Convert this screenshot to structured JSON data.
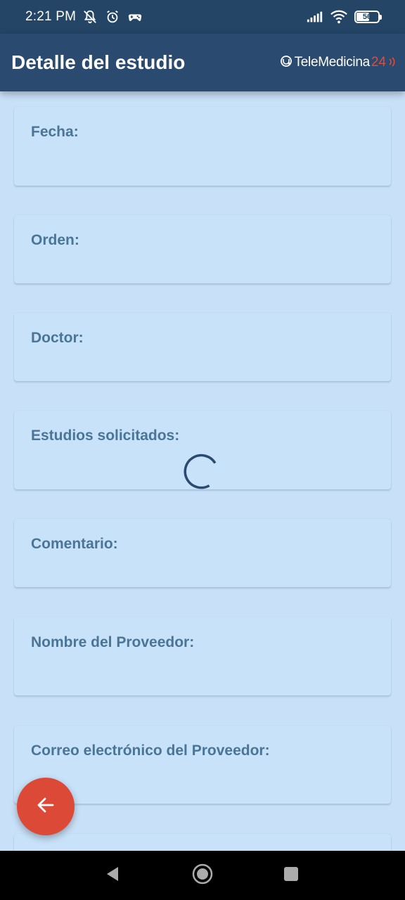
{
  "status_bar": {
    "time": "2:21 PM",
    "battery": "56",
    "icons": [
      "mute-notification-icon",
      "alarm-icon",
      "game-controller-icon",
      "signal-icon",
      "wifi-icon",
      "battery-icon"
    ]
  },
  "app_bar": {
    "title": "Detalle del estudio",
    "brand_name": "TeleMedicina",
    "brand_number": "24"
  },
  "cards": [
    {
      "label": "Fecha:"
    },
    {
      "label": "Orden:"
    },
    {
      "label": "Doctor:"
    },
    {
      "label": "Estudios solicitados:"
    },
    {
      "label": "Comentario:"
    },
    {
      "label": "Nombre del Proveedor:"
    },
    {
      "label": "Correo electrónico del Proveedor:"
    }
  ],
  "fab": {
    "icon": "arrow-back-icon"
  },
  "nav_bar": {
    "icons": [
      "back-triangle-icon",
      "home-circle-icon",
      "recents-square-icon"
    ]
  },
  "colors": {
    "status_bar": "#244566",
    "app_bar": "#2a4b6f",
    "background": "#c9e1f8",
    "label": "#4a7597",
    "fab": "#dc4a37",
    "brand_accent": "#e24b3b"
  }
}
